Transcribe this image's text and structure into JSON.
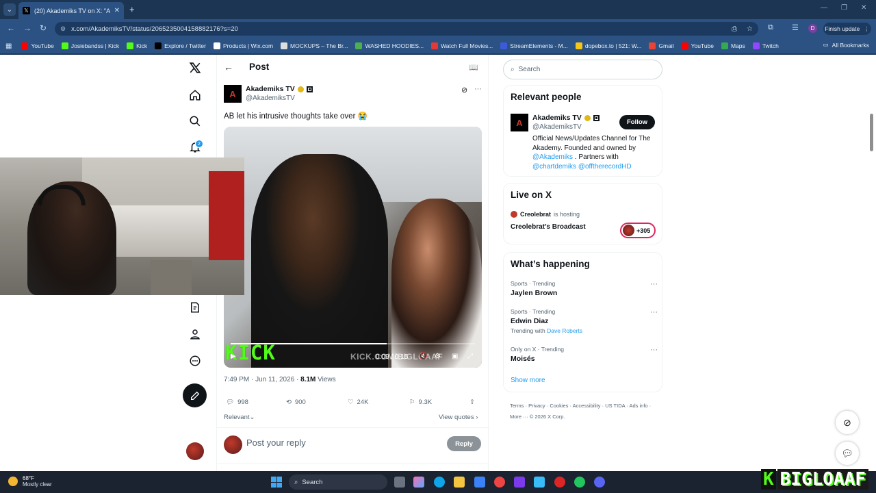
{
  "browser": {
    "tab_title": "(20) Akademiks TV on X: \"AB le",
    "url_main": "x.com/AkademiksTV/status/",
    "url_rest": "2065235004158882176?s=20",
    "finish_update": "Finish update",
    "profile_initial": "D",
    "all_bookmarks": "All Bookmarks",
    "bookmarks": [
      {
        "label": "YouTube",
        "color": "#ff0000"
      },
      {
        "label": "Josiebandss | Kick",
        "color": "#53fc18"
      },
      {
        "label": "Kick",
        "color": "#53fc18"
      },
      {
        "label": "Explore / Twitter",
        "color": "#000000"
      },
      {
        "label": "Products | Wix.com",
        "color": "#ffffff"
      },
      {
        "label": "MOCKUPS – The Br...",
        "color": "#dddddd"
      },
      {
        "label": "WASHED HOODIES...",
        "color": "#4caf50"
      },
      {
        "label": "Watch Full Movies...",
        "color": "#e53935"
      },
      {
        "label": "StreamElements - M...",
        "color": "#3b5bdb"
      },
      {
        "label": "dopebox.to | 521: W...",
        "color": "#f5c518"
      },
      {
        "label": "Gmail",
        "color": "#ea4335"
      },
      {
        "label": "YouTube",
        "color": "#ff0000"
      },
      {
        "label": "Maps",
        "color": "#34a853"
      },
      {
        "label": "Twitch",
        "color": "#9146ff"
      }
    ]
  },
  "x": {
    "header_title": "Post",
    "notification_count": "2",
    "author_name": "Akademiks TV",
    "author_handle": "@AkademiksTV",
    "post_text": "AB let his intrusive thoughts take over 😭",
    "video_time": "0:09 / 0:15",
    "video_progress": 0.64,
    "kick_overlay": "KICK",
    "kick_watermark": "KICK.COM/BIGLOAAF",
    "timestamp": "7:49 PM · Jun 11, 2026 · ",
    "views_count": "8.1M",
    "views_label": " Views",
    "stats": {
      "replies": "998",
      "reposts": "900",
      "likes": "24K",
      "bookmarks": "9.3K"
    },
    "sort_label": "Relevant",
    "view_quotes": "View quotes",
    "reply_placeholder": "Post your reply",
    "reply_button": "Reply"
  },
  "sidebar": {
    "search_placeholder": "Search",
    "relevant_people": {
      "title": "Relevant people",
      "name": "Akademiks TV",
      "handle": "@AkademiksTV",
      "follow": "Follow",
      "bio_1": "Official News/Updates Channel for The Akademy. Founded and owned by ",
      "bio_link1": "@Akademiks",
      "bio_2": " . Partners with ",
      "bio_link2": "@chartdemiks",
      "bio_link3": " @offtherecordHD"
    },
    "live": {
      "title": "Live on X",
      "host": "Creolebrat",
      "hosting": "is hosting",
      "broadcast": "Creolebrat’s Broadcast",
      "listeners": "+305"
    },
    "happening": {
      "title": "What’s happening",
      "trends": [
        {
          "category": "Sports · Trending",
          "name": "Jaylen Brown",
          "with_label": "",
          "with_link": ""
        },
        {
          "category": "Sports · Trending",
          "name": "Edwin Diaz",
          "with_label": "Trending with",
          "with_link": "Dave Roberts"
        },
        {
          "category": "Only on X · Trending",
          "name": "Moisés",
          "with_label": "",
          "with_link": ""
        }
      ],
      "show_more": "Show more"
    },
    "footer": "Terms · Privacy · Cookies · Accessibility · US TIDA · Ads info · More ··· © 2026 X Corp."
  },
  "taskbar": {
    "temp": "68°F",
    "weather": "Mostly clear",
    "search": "Search"
  },
  "stream_logo": {
    "k": "K",
    "name": "BIGLOAAF"
  }
}
